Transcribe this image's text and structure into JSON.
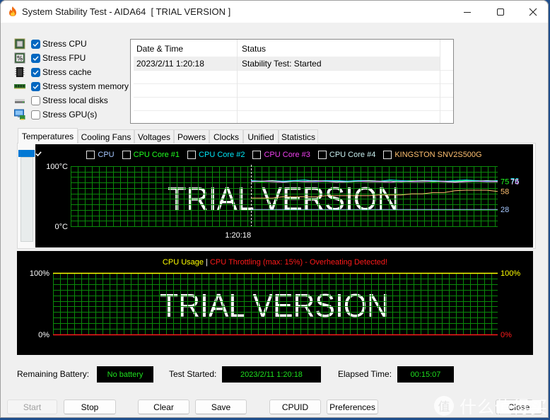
{
  "window": {
    "title": "System Stability Test - AIDA64  [ TRIAL VERSION ]",
    "app_icon": "flame-icon",
    "controls": [
      "minimize-icon",
      "maximize-icon",
      "close-icon"
    ]
  },
  "stress_options": [
    {
      "label": "Stress CPU",
      "checked": true,
      "icon": "cpu-chip-icon"
    },
    {
      "label": "Stress FPU",
      "checked": true,
      "icon": "fpu-icon"
    },
    {
      "label": "Stress cache",
      "checked": true,
      "icon": "cache-chip-icon"
    },
    {
      "label": "Stress system memory",
      "checked": true,
      "icon": "memory-module-icon"
    },
    {
      "label": "Stress local disks",
      "checked": false,
      "icon": "hard-disk-icon"
    },
    {
      "label": "Stress GPU(s)",
      "checked": false,
      "icon": "gpu-monitor-icon"
    }
  ],
  "log": {
    "columns": [
      "Date & Time",
      "Status"
    ],
    "rows": [
      {
        "datetime": "2023/2/11 1:20:18",
        "status": "Stability Test: Started"
      }
    ]
  },
  "tabs": [
    {
      "label": "Temperatures",
      "active": true
    },
    {
      "label": "Cooling Fans",
      "active": false
    },
    {
      "label": "Voltages",
      "active": false
    },
    {
      "label": "Powers",
      "active": false
    },
    {
      "label": "Clocks",
      "active": false
    },
    {
      "label": "Unified",
      "active": false
    },
    {
      "label": "Statistics",
      "active": false
    }
  ],
  "status_bar": {
    "battery_label": "Remaining Battery:",
    "battery_value": "No battery",
    "test_started_label": "Test Started:",
    "test_started_value": "2023/2/11 1:20:18",
    "elapsed_label": "Elapsed Time:",
    "elapsed_value": "00:15:07"
  },
  "buttons": {
    "start": {
      "label": "Start",
      "enabled": false
    },
    "stop": {
      "label": "Stop",
      "enabled": true
    },
    "clear": {
      "label": "Clear",
      "enabled": true
    },
    "save": {
      "label": "Save",
      "enabled": true
    },
    "cpuid": {
      "label": "CPUID",
      "enabled": true
    },
    "preferences": {
      "label": "Preferences",
      "enabled": true
    },
    "close": {
      "label": "Close",
      "enabled": true
    }
  },
  "watermark": {
    "badge": "值",
    "text": "什么值得买"
  },
  "colors": {
    "accent": "#0067c0",
    "status_text": "#1ee01e",
    "grid": "#0a8a0a",
    "chart_background": "#000000"
  },
  "chart_data": [
    {
      "type": "line",
      "title": "",
      "xlabel": "",
      "ylabel": "",
      "legend": "top-center",
      "grid": true,
      "ylim": [
        0,
        100
      ],
      "y_ticks": [
        {
          "value": 100,
          "label": "100°C"
        },
        {
          "value": 0,
          "label": "0°C"
        }
      ],
      "x_unit": "seconds since test start",
      "x_range": [
        -663,
        907
      ],
      "x_ticks": [
        {
          "value": 0,
          "label": "1:20:18"
        }
      ],
      "marker": {
        "x": 0,
        "style": "dashed"
      },
      "watermark_text": "TRIAL VERSION",
      "x": [
        0,
        39,
        79,
        118,
        158,
        197,
        237,
        276,
        315,
        355,
        394,
        434,
        473,
        512,
        552,
        591,
        631,
        670,
        710,
        749,
        789,
        828,
        867,
        907
      ],
      "series": [
        {
          "name": "CPU",
          "color": "#a6c8ff",
          "checked": true,
          "values": [
            28,
            28,
            28,
            28,
            28,
            28,
            28,
            28,
            28,
            28,
            28,
            28,
            28,
            28,
            28,
            28,
            28,
            28,
            28,
            28,
            28,
            28,
            28,
            28
          ]
        },
        {
          "name": "CPU Core #1",
          "color": "#20ff20",
          "checked": true,
          "values": [
            75,
            74,
            75,
            75,
            76,
            74,
            75,
            75,
            74,
            75,
            76,
            75,
            74,
            75,
            75,
            76,
            75,
            74,
            75,
            75,
            76,
            75,
            74,
            75
          ]
        },
        {
          "name": "CPU Core #2",
          "color": "#00e8f8",
          "checked": true,
          "values": [
            76,
            75,
            76,
            75,
            76,
            77,
            75,
            76,
            76,
            75,
            76,
            76,
            75,
            77,
            76,
            75,
            76,
            76,
            75,
            76,
            77,
            76,
            75,
            76
          ]
        },
        {
          "name": "CPU Core #3",
          "color": "#f040f0",
          "checked": true,
          "values": [
            74,
            75,
            74,
            73,
            75,
            74,
            74,
            75,
            73,
            74,
            75,
            74,
            74,
            73,
            75,
            74,
            74,
            75,
            74,
            73,
            74,
            75,
            74,
            74
          ]
        },
        {
          "name": "CPU Core #4",
          "color": "#c8f0f0",
          "checked": true,
          "values": [
            75,
            75,
            76,
            74,
            75,
            75,
            76,
            75,
            75,
            74,
            75,
            76,
            75,
            75,
            74,
            75,
            76,
            75,
            75,
            74,
            75,
            75,
            76,
            75
          ]
        },
        {
          "name": "KINGSTON SNV2S500G",
          "color": "#ffc070",
          "checked": true,
          "values": [
            47,
            47,
            47,
            49,
            49,
            49,
            49,
            51,
            51,
            51,
            51,
            51,
            52,
            52,
            52,
            54,
            54,
            56,
            56,
            59,
            60,
            60,
            60,
            58
          ]
        }
      ]
    },
    {
      "type": "line",
      "title_parts": [
        {
          "text": "CPU Usage",
          "color": "#ffff00"
        },
        {
          "text": " | ",
          "color": "#ffffff"
        },
        {
          "text": "CPU Throttling (max: 15%) - Overheating Detected!",
          "color": "#ff1a1a"
        }
      ],
      "xlabel": "",
      "ylabel": "",
      "grid": true,
      "ylim": [
        0,
        100
      ],
      "y_ticks_left": [
        {
          "value": 100,
          "label": "100%",
          "color": "#ffffff"
        },
        {
          "value": 0,
          "label": "0%",
          "color": "#ffffff"
        }
      ],
      "y_ticks_right": [
        {
          "value": 100,
          "label": "100%",
          "color": "#ffff00"
        },
        {
          "value": 0,
          "label": "0%",
          "color": "#ff1a1a"
        }
      ],
      "x_unit": "seconds since test start",
      "x_range": [
        -663,
        907
      ],
      "watermark_text": "TRIAL VERSION",
      "x": [
        -663,
        907
      ],
      "series": [
        {
          "name": "CPU Usage",
          "color": "#ffff00",
          "values": [
            100,
            100
          ]
        },
        {
          "name": "CPU Throttling",
          "color": "#ff1a1a",
          "values": [
            0,
            0
          ]
        }
      ]
    }
  ]
}
